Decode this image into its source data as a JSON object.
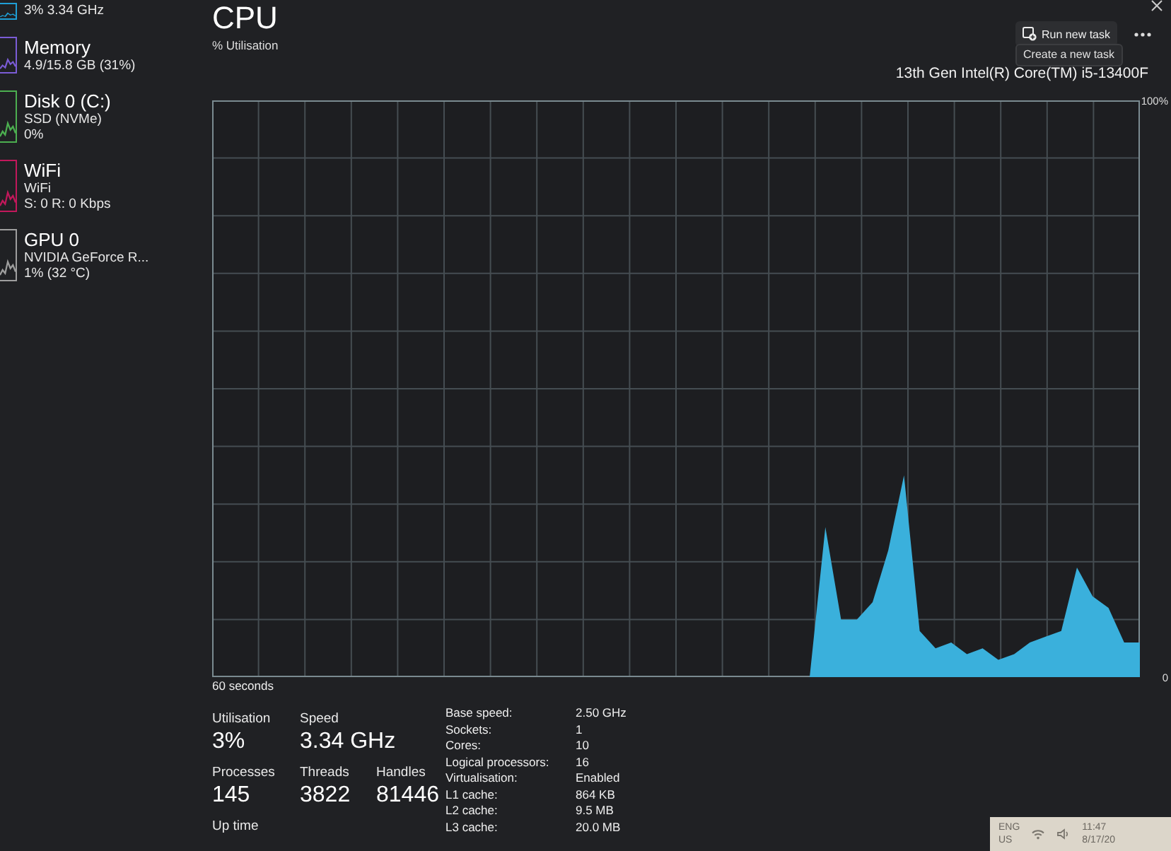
{
  "sidebar": {
    "items": [
      {
        "lines": [
          "3% 3.34 GHz"
        ],
        "color": "#1f9fd6"
      },
      {
        "title": "Memory",
        "lines": [
          "4.9/15.8 GB (31%)"
        ],
        "color": "#7b5cd6"
      },
      {
        "title": "Disk 0 (C:)",
        "lines": [
          "SSD (NVMe)",
          "0%"
        ],
        "color": "#4caf50"
      },
      {
        "title": "WiFi",
        "lines": [
          "WiFi",
          "S: 0 R: 0 Kbps"
        ],
        "color": "#c2185b"
      },
      {
        "title": "GPU 0",
        "lines": [
          "NVIDIA GeForce R...",
          "1% (32 °C)"
        ],
        "color": "#9e9e9e"
      }
    ]
  },
  "header": {
    "title": "CPU",
    "run_task_button": "Run new task",
    "tooltip": "Create a new task",
    "cpu_name": "13th Gen Intel(R) Core(TM) i5-13400F"
  },
  "graph": {
    "chart_data": {
      "type": "area",
      "ylabel": "% Utilisation",
      "xlabel": "60 seconds",
      "ylim": [
        0,
        100
      ],
      "yticks": [
        {
          "value": 0,
          "label": "0"
        },
        {
          "value": 100,
          "label": "100%"
        }
      ],
      "grid": true,
      "series": [
        {
          "color": "#3ab0dc",
          "values": [
            0,
            0,
            0,
            0,
            0,
            0,
            0,
            0,
            0,
            0,
            0,
            0,
            0,
            0,
            0,
            0,
            0,
            0,
            0,
            0,
            0,
            0,
            0,
            0,
            0,
            0,
            0,
            0,
            0,
            0,
            0,
            0,
            0,
            0,
            0,
            0,
            0,
            0,
            0,
            26,
            10,
            10,
            13,
            22,
            35,
            8,
            5,
            6,
            4,
            5,
            3,
            4,
            6,
            7,
            8,
            19,
            14,
            12,
            6,
            6
          ]
        }
      ]
    }
  },
  "stats": [
    [
      {
        "label": "Utilisation",
        "value": "3%"
      },
      {
        "label": "Speed",
        "value": "3.34 GHz"
      }
    ],
    [
      {
        "label": "Processes",
        "value": "145"
      },
      {
        "label": "Threads",
        "value": "3822"
      },
      {
        "label": "Handles",
        "value": "81446"
      }
    ],
    [
      {
        "label": "Up time"
      }
    ]
  ],
  "details": [
    {
      "label": "Base speed:",
      "value": "2.50 GHz"
    },
    {
      "label": "Sockets:",
      "value": "1"
    },
    {
      "label": "Cores:",
      "value": "10"
    },
    {
      "label": "Logical processors:",
      "value": "16"
    },
    {
      "label": "Virtualisation:",
      "value": "Enabled"
    },
    {
      "label": "L1 cache:",
      "value": "864 KB"
    },
    {
      "label": "L2 cache:",
      "value": "9.5 MB"
    },
    {
      "label": "L3 cache:",
      "value": "20.0 MB"
    }
  ],
  "taskbar": {
    "language": [
      "ENG",
      "US"
    ],
    "time": "11:47",
    "date": "8/17/20"
  }
}
